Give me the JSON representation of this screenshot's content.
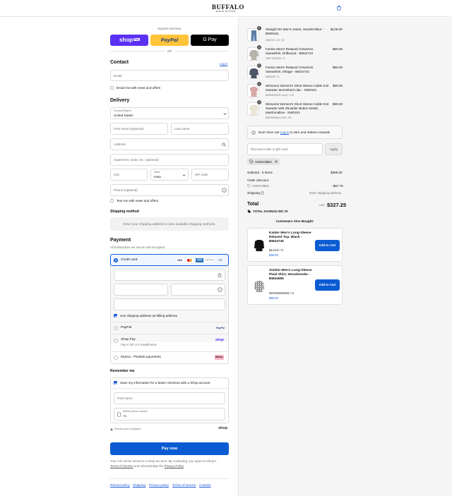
{
  "header": {
    "brand": "BUFFALO",
    "brand_sub": "DAVID BITTON"
  },
  "express": {
    "label": "Express checkout",
    "shop_pay": "shop",
    "shop_pay_badge": "Pay",
    "paypal": "PayPal",
    "gpay": "G Pay",
    "or": "OR"
  },
  "contact": {
    "title": "Contact",
    "login": "Log in",
    "email_placeholder": "Email",
    "newsletter": "Email me with news and offers"
  },
  "delivery": {
    "title": "Delivery",
    "country_label": "Country/Region",
    "country_value": "United States",
    "first_name": "First name (optional)",
    "last_name": "Last name",
    "address": "Address",
    "apartment": "Apartment, suite, etc. (optional)",
    "city": "City",
    "state_label": "State",
    "state_value": "Iowa",
    "zip": "ZIP code",
    "phone": "Phone (optional)",
    "sms": "Text me with news and offers"
  },
  "shipping": {
    "title": "Shipping method",
    "notice": "Enter your shipping address to view available shipping methods."
  },
  "payment": {
    "title": "Payment",
    "subtitle": "All transactions are secure and encrypted.",
    "credit_card": "Credit card",
    "card_more": "+3",
    "card_visa": "VISA",
    "card_amex": "AMEX",
    "card_discover": "DISCOVER",
    "use_shipping": "Use shipping address as billing address",
    "paypal": "PayPal",
    "paypal_logo": "PayPal",
    "shop_pay": "Shop Pay",
    "shop_pay_sub": "Pay in full or in installments",
    "shop_logo": "shop",
    "klarna": "Klarna - Flexible payments",
    "klarna_logo": "Klarna."
  },
  "remember": {
    "title": "Remember me",
    "save_info": "Save my information for a faster checkout with a Shop account",
    "first_name": "First name",
    "mobile_label": "Mobile phone number",
    "mobile_value": "+1",
    "secure": "Secure and encrypted",
    "shop_logo": "shop"
  },
  "pay_now": "Pay now",
  "legal": {
    "pre": "Your info will be saved to a Shop account. By continuing, you agree to Shop's",
    "terms": "Terms of Service",
    "mid": "and acknowledge the",
    "privacy": "Privacy Policy",
    "end": "."
  },
  "footer_links": [
    "Refund policy",
    "Shipping",
    "Privacy policy",
    "Terms of service",
    "Cookies"
  ],
  "items": [
    {
      "qty": "1",
      "name": "Straight Six Men's Jeans, Sanded Blue - BM26111",
      "variant": "INDIGO / 29 / 30",
      "price": "$129.00",
      "color": "#5a7ea8"
    },
    {
      "qty": "1",
      "name": "Famko Men's Relaxed Crewneck Sweatshirt, Driftwood - BM24742",
      "variant": "DRIFTWOOD / S",
      "price": "$69.00",
      "color": "#b7b3ab"
    },
    {
      "qty": "1",
      "name": "Famko Men's Relaxed Crewneck Sweatshirt, Mirage - BM24742",
      "variant": "MIRAGE / S",
      "price": "$69.00",
      "color": "#4d5566"
    },
    {
      "qty": "1",
      "name": "Winsome Women's Short Sleeve Cable Knit Sweater, Burnished Lilac - SW0151",
      "variant": "BURNISHED LILAC / XS",
      "price": "$59.00",
      "color": "#d8a9a9"
    },
    {
      "qty": "1",
      "name": "Winsome Women's Short Sleeve Cable Knit Sweater with Shoulder Button Detail, Marshmallow - SW0151",
      "variant": "MARSHMALLOW / XS",
      "price": "$59.00",
      "color": "#ece6d6"
    }
  ],
  "rewards": {
    "pre": "Don't miss out!",
    "link": "Log in",
    "post": "to earn and redeem rewards"
  },
  "discount": {
    "placeholder": "Discount code or gift card",
    "apply": "Apply",
    "tag": "ADDSVIBES"
  },
  "summary": {
    "subtotal_label": "Subtotal · 5 items",
    "subtotal_value": "$385.00",
    "order_discount": "Order discount",
    "code": "ADDSVIBES",
    "discount_value": "- $57.75",
    "shipping_label": "Shipping",
    "shipping_value": "Enter shipping address",
    "total_label": "Total",
    "currency": "USD",
    "total_value": "$327.25",
    "savings_label": "TOTAL SAVINGS",
    "savings_value": "$57.75"
  },
  "upsell": {
    "title": "Customers Also Bought:",
    "cards": [
      {
        "name": "Kaider Men's Long-Sleeve Relaxed Top, Black - BM24740",
        "variant": "BLACK / S",
        "price": "$49.00",
        "button": "Add to Cart"
      },
      {
        "name": "Simbio Men's Long-Sleeve Plaid Shirt, Woodsmoke - BM24685",
        "variant": "WOODSMOKE / S",
        "price": "$69.00",
        "button": "Add to Cart"
      }
    ]
  },
  "colors": {
    "accent": "#0b5bd3",
    "shop_purple": "#5a31f4",
    "paypal_yellow": "#ffc439",
    "link": "#1a5bd7"
  }
}
